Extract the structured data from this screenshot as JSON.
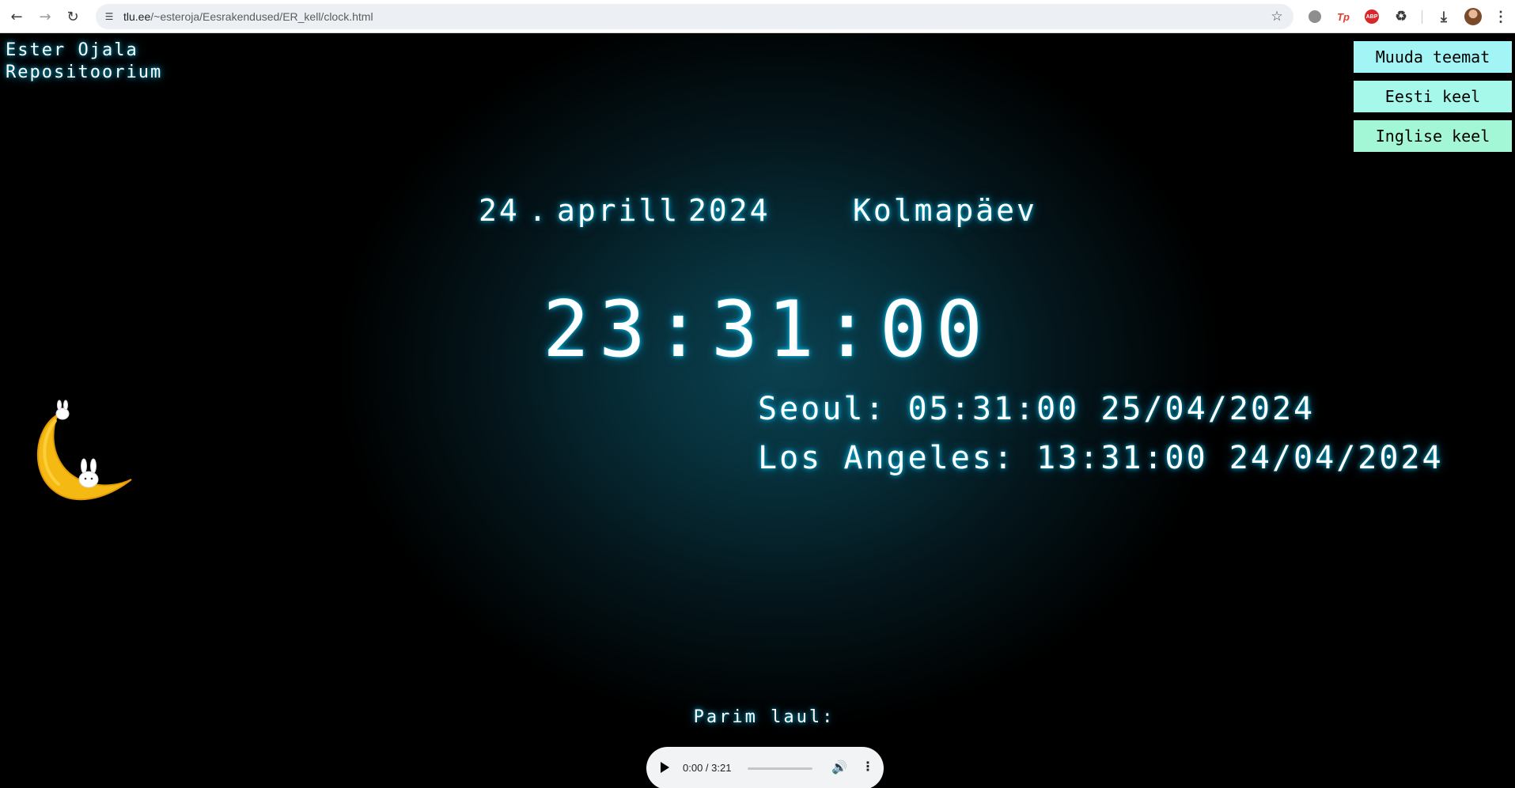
{
  "browser": {
    "url_host": "tlu.ee",
    "url_path": "/~esteroja/Eesrakendused/ER_kell/clock.html"
  },
  "header": {
    "author_line1": "Ester Ojala",
    "author_line2": "Repositoorium"
  },
  "buttons": {
    "theme": "Muuda teemat",
    "estonian": "Eesti keel",
    "english": "Inglise keel"
  },
  "date": {
    "day": "24",
    "separator": ".",
    "month": "aprill",
    "year": "2024",
    "weekday": "Kolmapäev"
  },
  "time": {
    "main": "23:31:00"
  },
  "world_clocks": [
    {
      "label": "Seoul: 05:31:00 25/04/2024"
    },
    {
      "label": "Los Angeles: 13:31:00 24/04/2024"
    }
  ],
  "song": {
    "label": "Parim laul:",
    "player_time": "0:00 / 3:21",
    "progress": 0
  }
}
